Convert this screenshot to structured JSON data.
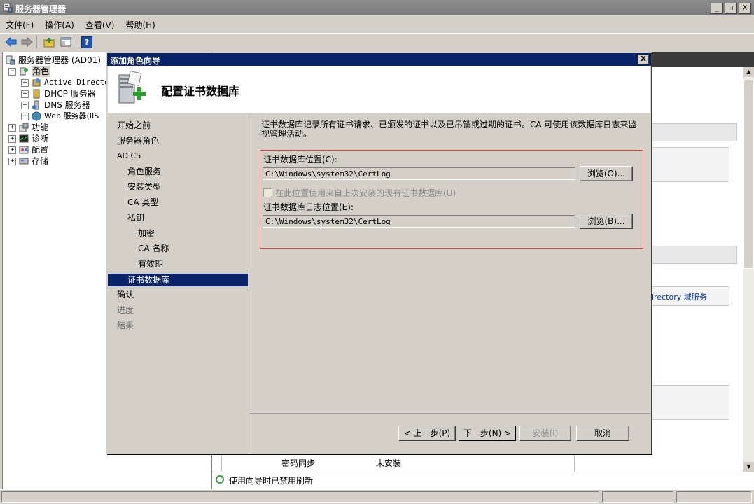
{
  "window": {
    "title": "服务器管理器",
    "controls": [
      "_",
      "□",
      "X"
    ]
  },
  "menu": [
    "文件(F)",
    "操作(A)",
    "查看(V)",
    "帮助(H)"
  ],
  "toolbar": {
    "icons": [
      "back-arrow-icon",
      "forward-arrow-icon",
      "up-folder-icon",
      "properties-icon",
      "help-icon"
    ],
    "help_glyph": "?"
  },
  "tree": {
    "root": "服务器管理器 (AD01)",
    "items": [
      {
        "label": "角色",
        "expander": "−",
        "level": 1
      },
      {
        "label": "Active Directo",
        "expander": "+",
        "level": 2
      },
      {
        "label": "DHCP 服务器",
        "expander": "+",
        "level": 2
      },
      {
        "label": "DNS 服务器",
        "expander": "+",
        "level": 2
      },
      {
        "label": "Web 服务器(IIS",
        "expander": "+",
        "level": 2
      },
      {
        "label": "功能",
        "expander": "+",
        "level": 1
      },
      {
        "label": "诊断",
        "expander": "+",
        "level": 1
      },
      {
        "label": "配置",
        "expander": "+",
        "level": 1
      },
      {
        "label": "存储",
        "expander": "+",
        "level": 1
      }
    ]
  },
  "background_pane": {
    "partial_link": "irectory 域服务",
    "table_rows": [
      {
        "name": "密码同步",
        "status": "未安装"
      }
    ],
    "status_text": "使用向导时已禁用刷新"
  },
  "dialog": {
    "title": "添加角色向导",
    "close_glyph": "X",
    "header_title": "配置证书数据库",
    "nav": [
      {
        "label": "开始之前",
        "indent": 0,
        "state": "normal"
      },
      {
        "label": "服务器角色",
        "indent": 0,
        "state": "normal"
      },
      {
        "label": "AD CS",
        "indent": 0,
        "state": "normal"
      },
      {
        "label": "角色服务",
        "indent": 1,
        "state": "normal"
      },
      {
        "label": "安装类型",
        "indent": 1,
        "state": "normal"
      },
      {
        "label": "CA 类型",
        "indent": 1,
        "state": "normal"
      },
      {
        "label": "私钥",
        "indent": 1,
        "state": "normal"
      },
      {
        "label": "加密",
        "indent": 2,
        "state": "normal"
      },
      {
        "label": "CA 名称",
        "indent": 2,
        "state": "normal"
      },
      {
        "label": "有效期",
        "indent": 2,
        "state": "normal"
      },
      {
        "label": "证书数据库",
        "indent": 1,
        "state": "selected"
      },
      {
        "label": "确认",
        "indent": 0,
        "state": "normal"
      },
      {
        "label": "进度",
        "indent": 0,
        "state": "dim"
      },
      {
        "label": "结果",
        "indent": 0,
        "state": "dim"
      }
    ],
    "description_line1": "证书数据库记录所有证书请求、已颁发的证书以及已吊销或过期的证书。CA 可使用该数据库日志来监",
    "description_line2": "视管理活动。",
    "db_location_label": "证书数据库位置(C):",
    "db_location_value": "C:\\Windows\\system32\\CertLog",
    "browse1_label": "浏览(O)...",
    "reuse_checkbox_label": "在此位置使用来自上次安装的现有证书数据库(U)",
    "log_location_label": "证书数据库日志位置(E):",
    "log_location_value": "C:\\Windows\\system32\\CertLog",
    "browse2_label": "浏览(B)...",
    "buttons": {
      "prev": "< 上一步(P)",
      "next": "下一步(N) >",
      "install": "安装(I)",
      "cancel": "取消"
    }
  },
  "colors": {
    "title_active": "#0a246a",
    "highlight_box": "#e03a3a",
    "face": "#d4d0c8"
  }
}
